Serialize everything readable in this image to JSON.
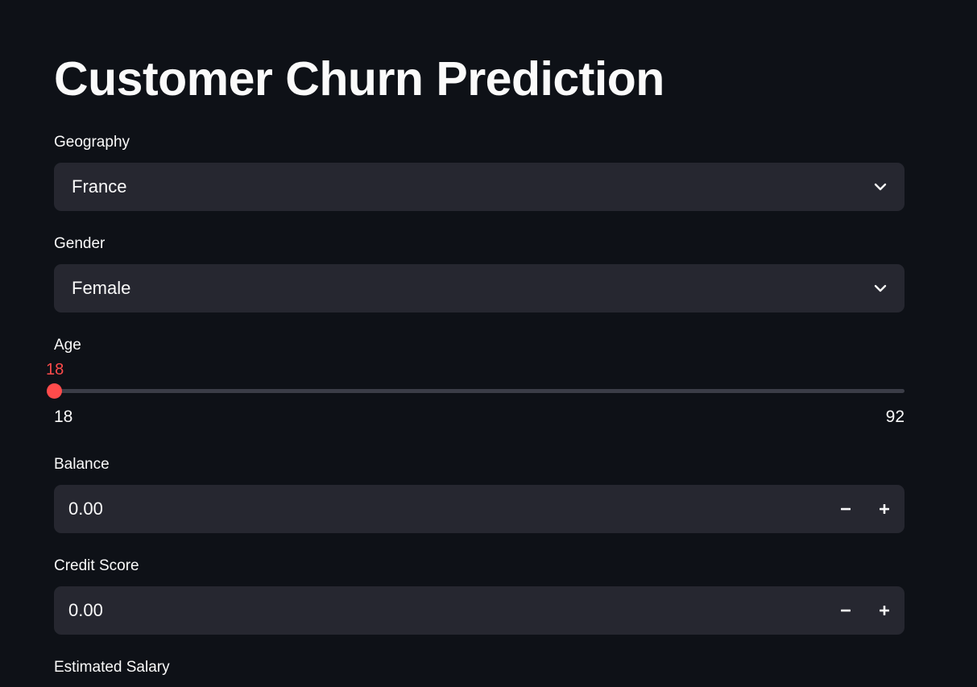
{
  "page": {
    "title": "Customer Churn Prediction"
  },
  "fields": {
    "geography": {
      "label": "Geography",
      "value": "France"
    },
    "gender": {
      "label": "Gender",
      "value": "Female"
    },
    "age": {
      "label": "Age",
      "value": "18",
      "min": "18",
      "max": "92",
      "fraction": 0.0
    },
    "balance": {
      "label": "Balance",
      "value": "0.00"
    },
    "credit_score": {
      "label": "Credit Score",
      "value": "0.00"
    },
    "estimated_salary": {
      "label": "Estimated Salary"
    }
  },
  "icons": {
    "dropdown": "chevron-down-icon",
    "decrement": "minus-icon",
    "increment": "plus-icon"
  },
  "colors": {
    "background": "#0e1117",
    "input_background": "#262730",
    "accent": "#ff4b4b",
    "text": "#fafafa"
  }
}
